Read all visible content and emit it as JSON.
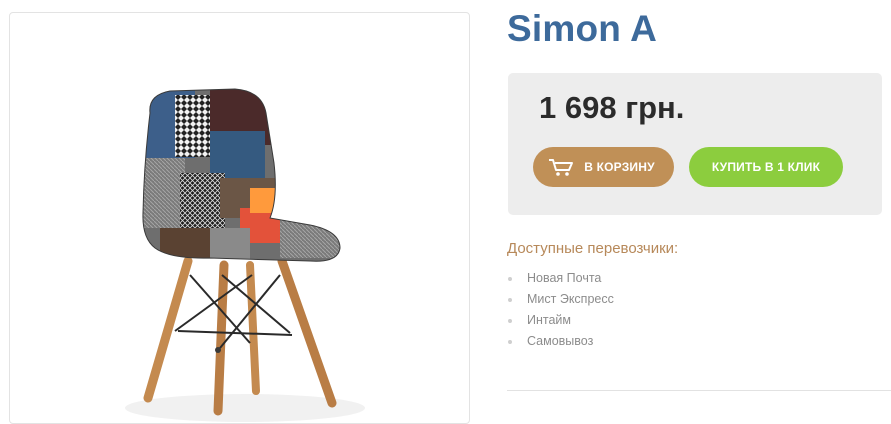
{
  "product": {
    "title": "Simon A",
    "image_icon": "patchwork-chair-photo"
  },
  "purchase": {
    "price": "1 698 грн.",
    "cart_button_label": "В КОРЗИНУ",
    "cart_icon": "cart-icon",
    "one_click_button_label": "КУПИТЬ В 1 КЛИК",
    "colors": {
      "cart": "#c09057",
      "one_click": "#8ccd3e",
      "title": "#3d6a9b"
    }
  },
  "carriers": {
    "title": "Доступные перевозчики:",
    "items": [
      {
        "label": "Новая Почта"
      },
      {
        "label": "Мист Экспресс"
      },
      {
        "label": "Интайм"
      },
      {
        "label": "Самовывоз"
      }
    ]
  }
}
